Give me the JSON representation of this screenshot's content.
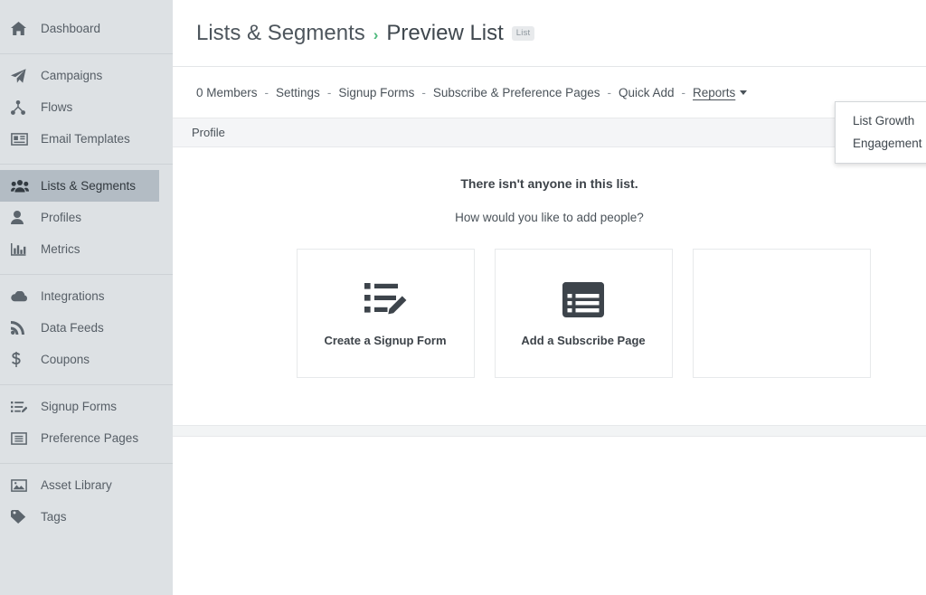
{
  "sidebar": {
    "groups": [
      {
        "items": [
          {
            "label": "Dashboard",
            "icon": "home-icon",
            "active": false
          }
        ]
      },
      {
        "items": [
          {
            "label": "Campaigns",
            "icon": "paper-plane-icon",
            "active": false
          },
          {
            "label": "Flows",
            "icon": "flow-branch-icon",
            "active": false
          },
          {
            "label": "Email Templates",
            "icon": "email-template-icon",
            "active": false
          }
        ]
      },
      {
        "items": [
          {
            "label": "Lists & Segments",
            "icon": "people-group-icon",
            "active": true
          },
          {
            "label": "Profiles",
            "icon": "person-icon",
            "active": false
          },
          {
            "label": "Metrics",
            "icon": "bar-chart-icon",
            "active": false
          }
        ]
      },
      {
        "items": [
          {
            "label": "Integrations",
            "icon": "cloud-icon",
            "active": false
          },
          {
            "label": "Data Feeds",
            "icon": "rss-feed-icon",
            "active": false
          },
          {
            "label": "Coupons",
            "icon": "dollar-sign-icon",
            "active": false
          }
        ]
      },
      {
        "items": [
          {
            "label": "Signup Forms",
            "icon": "signup-form-icon",
            "active": false
          },
          {
            "label": "Preference Pages",
            "icon": "preference-page-icon",
            "active": false
          }
        ]
      },
      {
        "items": [
          {
            "label": "Asset Library",
            "icon": "image-library-icon",
            "active": false
          },
          {
            "label": "Tags",
            "icon": "tag-icon",
            "active": false
          }
        ]
      }
    ]
  },
  "header": {
    "parent_label": "Lists & Segments",
    "separator": "›",
    "current_label": "Preview List",
    "badge": "List"
  },
  "subnav": {
    "separator": "-",
    "items": [
      {
        "label": "0 Members"
      },
      {
        "label": "Settings"
      },
      {
        "label": "Signup Forms"
      },
      {
        "label": "Subscribe & Preference Pages"
      },
      {
        "label": "Quick Add"
      },
      {
        "label": "Reports",
        "has_caret": true,
        "open": true
      }
    ]
  },
  "reports_menu": {
    "items": [
      {
        "label": "List Growth"
      },
      {
        "label": "Engagement"
      }
    ]
  },
  "table": {
    "columns": [
      "Profile"
    ],
    "rows": []
  },
  "empty_state": {
    "title": "There isn't anyone in this list.",
    "subtitle": "How would you like to add people?",
    "cards": [
      {
        "label": "Create a Signup Form",
        "icon": "list-with-pencil-icon"
      },
      {
        "label": "Add a Subscribe Page",
        "icon": "subscribe-page-icon"
      },
      {
        "label": "",
        "icon": ""
      }
    ]
  },
  "colors": {
    "sidebar_bg": "#dde1e4",
    "sidebar_active_bg": "#b3bcc4",
    "breadcrumb_accent": "#4fba7d",
    "text_primary": "#3f474e",
    "text_muted": "#8c959c",
    "band_bg": "#f4f5f7"
  }
}
